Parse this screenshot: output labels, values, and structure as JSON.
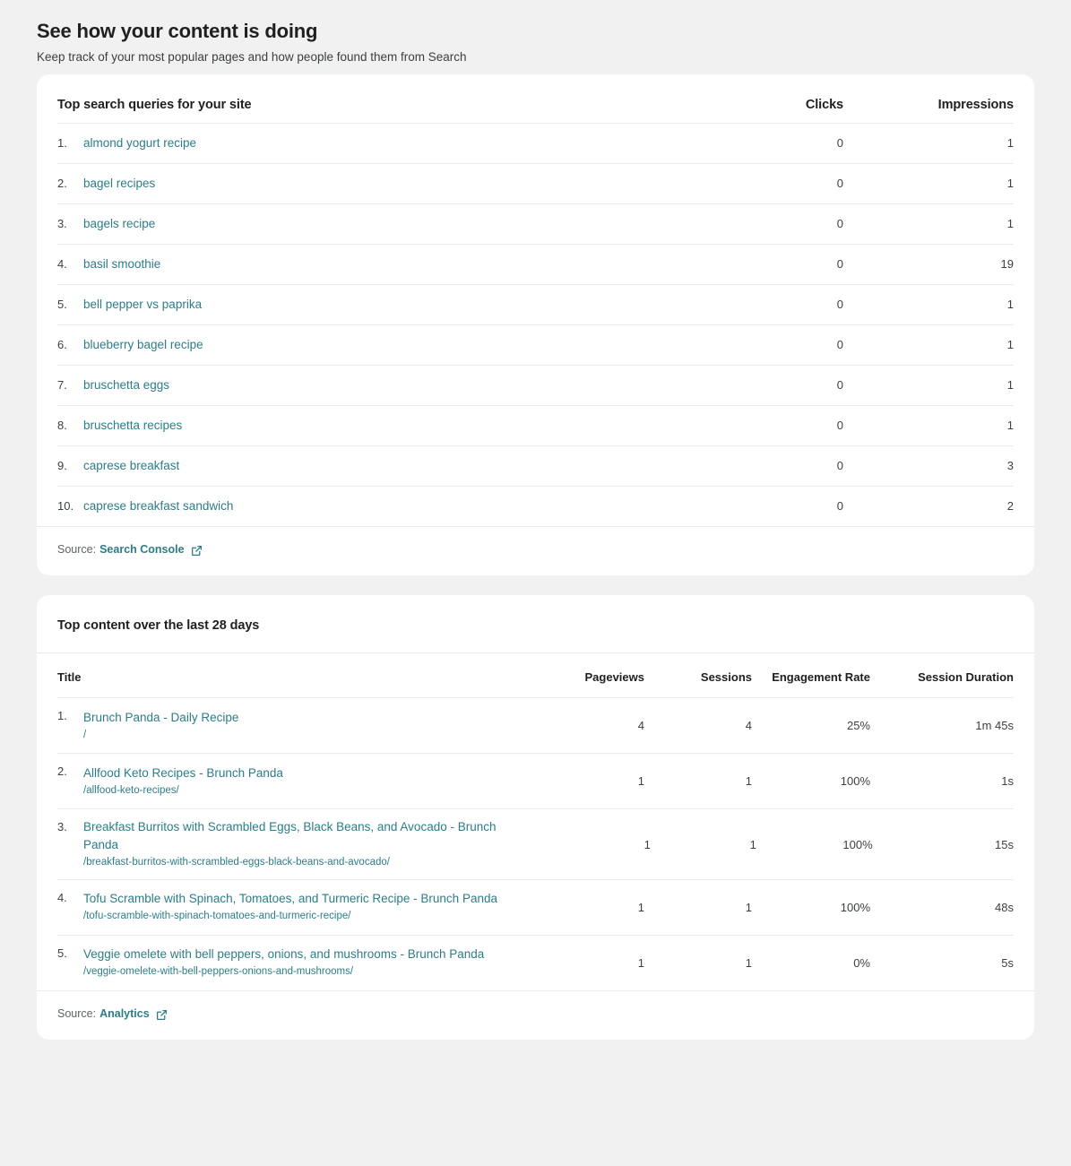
{
  "page": {
    "title": "See how your content is doing",
    "subtitle": "Keep track of your most popular pages and how people found them from Search"
  },
  "colors": {
    "link": "#2d7d87",
    "page_background": "#f1f1f1",
    "card_background": "#ffffff",
    "divider": "#e8eaed",
    "text": "#202124"
  },
  "queries_card": {
    "title": "Top search queries for your site",
    "columns": {
      "query": "",
      "clicks": "Clicks",
      "impressions": "Impressions"
    },
    "rows": [
      {
        "rank": "1.",
        "query": "almond yogurt recipe",
        "clicks": "0",
        "impressions": "1"
      },
      {
        "rank": "2.",
        "query": "bagel recipes",
        "clicks": "0",
        "impressions": "1"
      },
      {
        "rank": "3.",
        "query": "bagels recipe",
        "clicks": "0",
        "impressions": "1"
      },
      {
        "rank": "4.",
        "query": "basil smoothie",
        "clicks": "0",
        "impressions": "19"
      },
      {
        "rank": "5.",
        "query": "bell pepper vs paprika",
        "clicks": "0",
        "impressions": "1"
      },
      {
        "rank": "6.",
        "query": "blueberry bagel recipe",
        "clicks": "0",
        "impressions": "1"
      },
      {
        "rank": "7.",
        "query": "bruschetta eggs",
        "clicks": "0",
        "impressions": "1"
      },
      {
        "rank": "8.",
        "query": "bruschetta recipes",
        "clicks": "0",
        "impressions": "1"
      },
      {
        "rank": "9.",
        "query": "caprese breakfast",
        "clicks": "0",
        "impressions": "3"
      },
      {
        "rank": "10.",
        "query": "caprese breakfast sandwich",
        "clicks": "0",
        "impressions": "2"
      }
    ],
    "footer": {
      "label": "Source:",
      "link": "Search Console",
      "icon": "external-link-icon"
    }
  },
  "content_card": {
    "title": "Top content over the last 28 days",
    "columns": {
      "title": "Title",
      "pageviews": "Pageviews",
      "sessions": "Sessions",
      "engagement_rate": "Engagement Rate",
      "session_duration": "Session Duration"
    },
    "rows": [
      {
        "rank": "1.",
        "title": "Brunch Panda - Daily Recipe",
        "url": "/",
        "pageviews": "4",
        "sessions": "4",
        "engagement_rate": "25%",
        "session_duration": "1m 45s"
      },
      {
        "rank": "2.",
        "title": "Allfood Keto Recipes - Brunch Panda",
        "url": "/allfood-keto-recipes/",
        "pageviews": "1",
        "sessions": "1",
        "engagement_rate": "100%",
        "session_duration": "1s"
      },
      {
        "rank": "3.",
        "title": "Breakfast Burritos with Scrambled Eggs, Black Beans, and Avocado - Brunch Panda",
        "url": "/breakfast-burritos-with-scrambled-eggs-black-beans-and-avocado/",
        "pageviews": "1",
        "sessions": "1",
        "engagement_rate": "100%",
        "session_duration": "15s"
      },
      {
        "rank": "4.",
        "title": "Tofu Scramble with Spinach, Tomatoes, and Turmeric Recipe - Brunch Panda",
        "url": "/tofu-scramble-with-spinach-tomatoes-and-turmeric-recipe/",
        "pageviews": "1",
        "sessions": "1",
        "engagement_rate": "100%",
        "session_duration": "48s"
      },
      {
        "rank": "5.",
        "title": "Veggie omelete with bell peppers, onions, and mushrooms - Brunch Panda",
        "url": "/veggie-omelete-with-bell-peppers-onions-and-mushrooms/",
        "pageviews": "1",
        "sessions": "1",
        "engagement_rate": "0%",
        "session_duration": "5s"
      }
    ],
    "footer": {
      "label": "Source:",
      "link": "Analytics",
      "icon": "external-link-icon"
    }
  }
}
